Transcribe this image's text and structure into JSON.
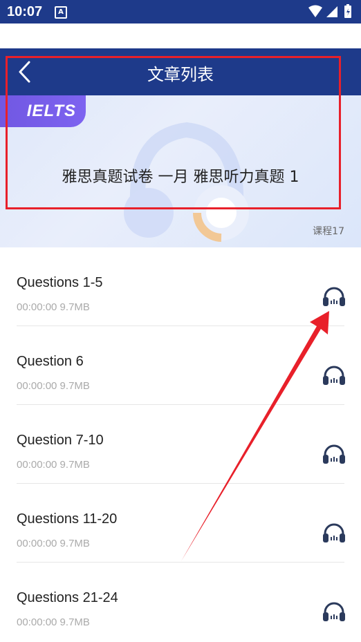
{
  "status_bar": {
    "time": "10:07",
    "notification_letter": "A"
  },
  "header": {
    "title": "文章列表",
    "back_icon": "chevron-left-icon"
  },
  "banner": {
    "tag": "IELTS",
    "title": "雅思真题试卷 一月 雅思听力真题 1",
    "lesson_count": "课程17"
  },
  "items": [
    {
      "title": "Questions 1-5",
      "meta": "00:00:00 9.7MB",
      "icon": "headphones-icon"
    },
    {
      "title": "Question 6",
      "meta": "00:00:00 9.7MB",
      "icon": "headphones-icon"
    },
    {
      "title": "Question 7-10",
      "meta": "00:00:00 9.7MB",
      "icon": "headphones-icon"
    },
    {
      "title": "Questions 11-20",
      "meta": "00:00:00 9.7MB",
      "icon": "headphones-icon"
    },
    {
      "title": "Questions 21-24",
      "meta": "00:00:00 9.7MB",
      "icon": "headphones-icon"
    }
  ],
  "colors": {
    "header_bg": "#1e3a8a",
    "annotation": "#e8202a",
    "tag_bg": "#7d63f0"
  }
}
